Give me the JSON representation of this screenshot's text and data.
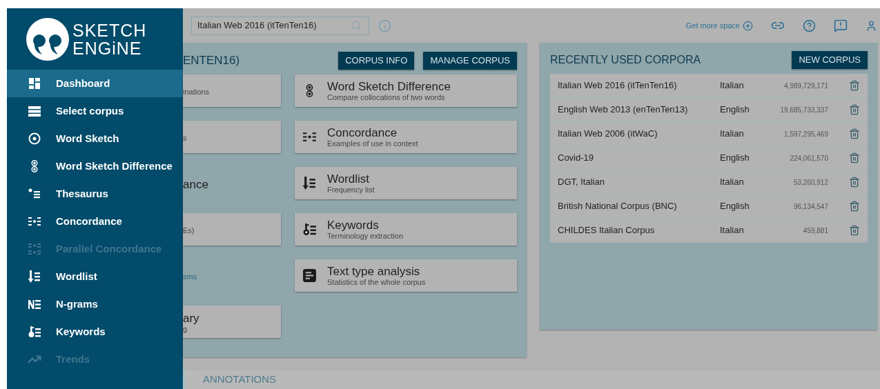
{
  "logo": {
    "lines": [
      "SKETCH",
      "ENGiNE"
    ]
  },
  "sidebar": {
    "items": [
      {
        "label": "Dashboard",
        "kind": "dashboard",
        "selected": true,
        "disabled": false
      },
      {
        "label": "Select corpus",
        "kind": "corpus",
        "selected": false,
        "disabled": false
      },
      {
        "label": "Word Sketch",
        "kind": "wordsketch",
        "selected": false,
        "disabled": false
      },
      {
        "label": "Word Sketch Difference",
        "kind": "wsdiff",
        "selected": false,
        "disabled": false
      },
      {
        "label": "Thesaurus",
        "kind": "thesaurus",
        "selected": false,
        "disabled": false
      },
      {
        "label": "Concordance",
        "kind": "concordance",
        "selected": false,
        "disabled": false
      },
      {
        "label": "Parallel Concordance",
        "kind": "parconc",
        "selected": false,
        "disabled": true
      },
      {
        "label": "Wordlist",
        "kind": "wordlist",
        "selected": false,
        "disabled": false
      },
      {
        "label": "N-grams",
        "kind": "ngrams",
        "selected": false,
        "disabled": false
      },
      {
        "label": "Keywords",
        "kind": "keywords",
        "selected": false,
        "disabled": false
      },
      {
        "label": "Trends",
        "kind": "trends",
        "selected": false,
        "disabled": true
      }
    ]
  },
  "search": {
    "value": "Italian Web 2016 (itTenTen16)"
  },
  "header": {
    "space_link": "Get more space"
  },
  "corpus_panel": {
    "title": "ENTEN16)",
    "buttons": [
      "CORPUS INFO",
      "MANAGE CORPUS"
    ],
    "left_column": [
      {
        "kind": "card",
        "subtitle": "inations"
      },
      {
        "kind": "card",
        "subtitle": "s"
      },
      {
        "kind": "plain",
        "title": "ance"
      },
      {
        "kind": "card",
        "subtitle": "Es)"
      },
      {
        "kind": "plain",
        "subtitle": "sms"
      },
      {
        "kind": "card",
        "title": "ary",
        "subtitle": "g"
      }
    ],
    "right_column": [
      {
        "kind": "wsdiff",
        "title": "Word Sketch Difference",
        "subtitle": "Compare collocations of two words"
      },
      {
        "kind": "concordance",
        "title": "Concordance",
        "subtitle": "Examples of use in context"
      },
      {
        "kind": "wordlist",
        "title": "Wordlist",
        "subtitle": "Frequency list"
      },
      {
        "kind": "keywords",
        "title": "Keywords",
        "subtitle": "Terminology extraction"
      },
      {
        "kind": "texttype",
        "title": "Text type analysis",
        "subtitle": "Statistics of the whole corpus"
      }
    ]
  },
  "recent": {
    "title": "RECENTLY USED CORPORA",
    "button": "NEW CORPUS",
    "rows": [
      {
        "name": "Italian Web 2016 (itTenTen16)",
        "language": "Italian",
        "size": "4,989,729,171"
      },
      {
        "name": "English Web 2013 (enTenTen13)",
        "language": "English",
        "size": "19,685,733,337"
      },
      {
        "name": "Italian Web 2006 (itWaC)",
        "language": "Italian",
        "size": "1,597,295,469"
      },
      {
        "name": "Covid-19",
        "language": "English",
        "size": "224,061,570"
      },
      {
        "name": "DGT, Italian",
        "language": "Italian",
        "size": "53,260,912"
      },
      {
        "name": "British National Corpus (BNC)",
        "language": "English",
        "size": "96,134,547"
      },
      {
        "name": "CHILDES Italian Corpus",
        "language": "Italian",
        "size": "459,881"
      }
    ]
  },
  "tabs": [
    {
      "label": "ANNOTATIONS",
      "selected": false
    }
  ]
}
